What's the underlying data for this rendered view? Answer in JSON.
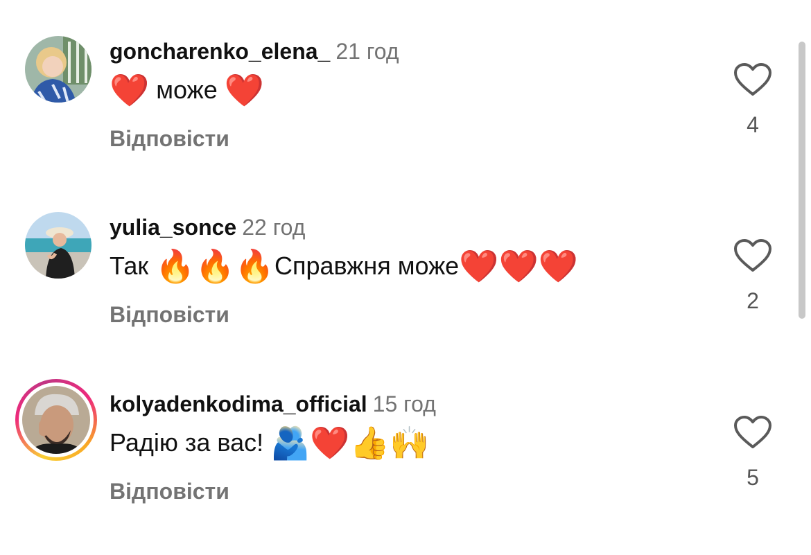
{
  "comments": [
    {
      "username": "goncharenko_elena_",
      "time": "21 год",
      "text_parts": [
        "❤️",
        " може ",
        "❤️"
      ],
      "reply_label": "Відповісти",
      "likes": "4",
      "icons": [
        "heart-outline-icon"
      ]
    },
    {
      "username": "yulia_sonce",
      "time": "22 год",
      "text_parts": [
        "Так ",
        "🔥",
        "🔥",
        "🔥",
        "Справжня може",
        "❤️",
        "❤️",
        "❤️"
      ],
      "reply_label": "Відповісти",
      "likes": "2",
      "icons": [
        "heart-outline-icon"
      ]
    },
    {
      "username": "kolyadenkodima_official",
      "time": "15 год",
      "text_parts": [
        "Радію за вас! ",
        "🫂",
        "❤️",
        "👍",
        "🙌"
      ],
      "reply_label": "Відповісти",
      "likes": "5",
      "icons": [
        "heart-outline-icon"
      ]
    }
  ],
  "colors": {
    "secondary_text": "#737373",
    "story_ring_start": "#f9ce34",
    "story_ring_end": "#ee2a7b"
  }
}
